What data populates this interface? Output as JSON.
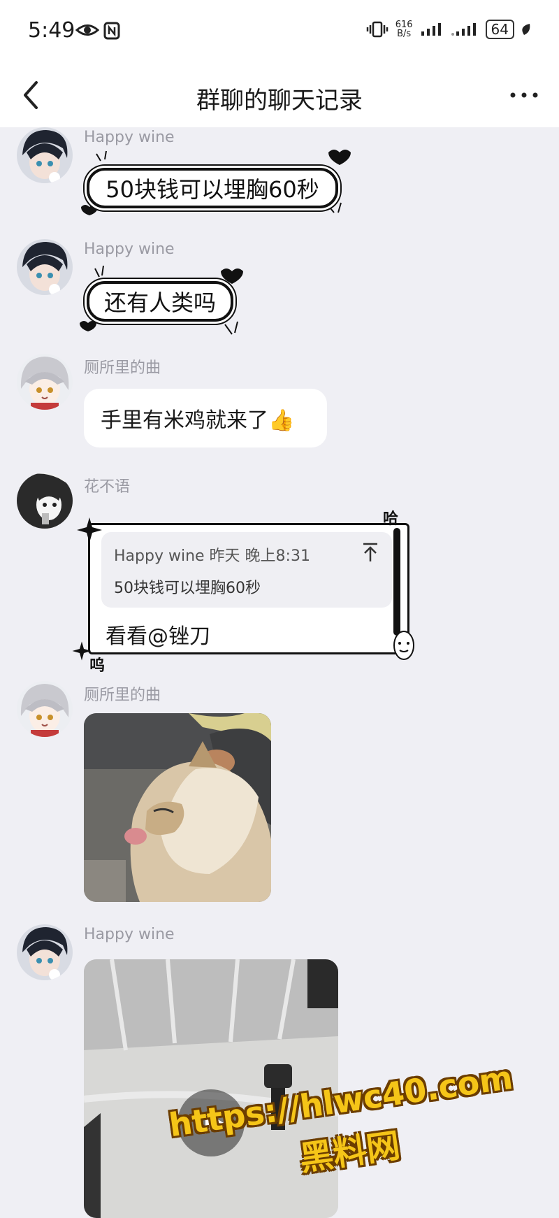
{
  "status_bar": {
    "time": "5:49",
    "net_speed_value": "616",
    "net_speed_unit": "B/s",
    "battery": "64"
  },
  "nav": {
    "title": "群聊的聊天记录"
  },
  "messages": [
    {
      "sender": "Happy wine",
      "text": "50块钱可以埋胸60秒"
    },
    {
      "sender": "Happy wine",
      "text": "还有人类吗"
    },
    {
      "sender": "厕所里的曲",
      "text": "手里有米鸡就来了👍"
    },
    {
      "sender": "花不语",
      "quote_header": "Happy wine 昨天 晚上8:31",
      "quote_text": "50块钱可以埋胸60秒",
      "text": "看看@锉刀",
      "deco_top_right": "哈",
      "deco_bottom_left": "呜"
    },
    {
      "sender": "厕所里的曲"
    },
    {
      "sender": "Happy wine"
    }
  ],
  "watermark": {
    "url": "https://hlwc40.com",
    "name": "黑料网"
  },
  "colors": {
    "page_bg": "#efeff4",
    "sender_name": "#9a9aa3",
    "watermark_fill": "#f5c518",
    "watermark_outline": "#6b3d00"
  }
}
